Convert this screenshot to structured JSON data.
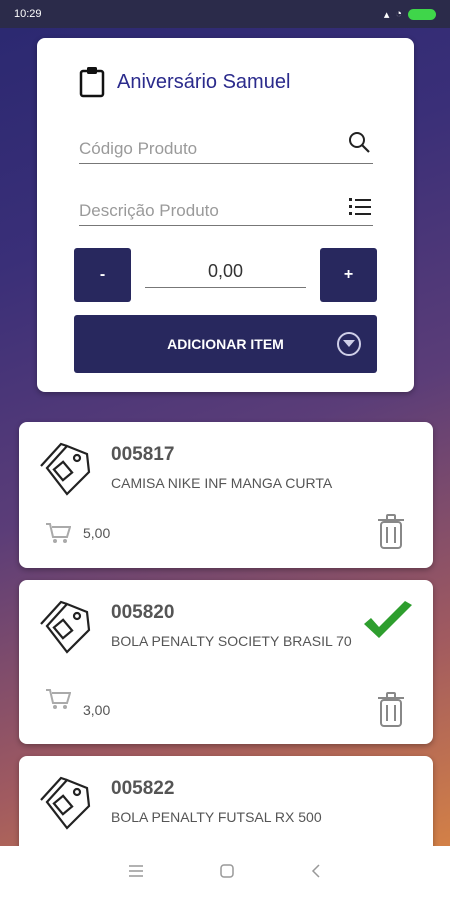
{
  "status": {
    "time": "10:29"
  },
  "header": {
    "title": "Aniversário Samuel"
  },
  "form": {
    "code_placeholder": "Código Produto",
    "desc_placeholder": "Descrição Produto",
    "minus_label": "-",
    "plus_label": "+",
    "quantity": "0,00",
    "add_label": "ADICIONAR ITEM"
  },
  "items": [
    {
      "code": "005817",
      "description": "CAMISA NIKE INF MANGA CURTA",
      "quantity": "5,00",
      "checked": false
    },
    {
      "code": "005820",
      "description": "BOLA PENALTY SOCIETY BRASIL 70",
      "quantity": "3,00",
      "checked": true
    },
    {
      "code": "005822",
      "description": "BOLA PENALTY FUTSAL RX 500",
      "quantity": "",
      "checked": false
    }
  ],
  "colors": {
    "primary": "#28285e",
    "title": "#2b2b8c",
    "check": "#2e9e2e"
  },
  "icons": [
    "clipboard-icon",
    "search-icon",
    "list-icon",
    "tag-icon",
    "cart-icon",
    "trash-icon",
    "check-icon",
    "chevron-down-icon"
  ]
}
